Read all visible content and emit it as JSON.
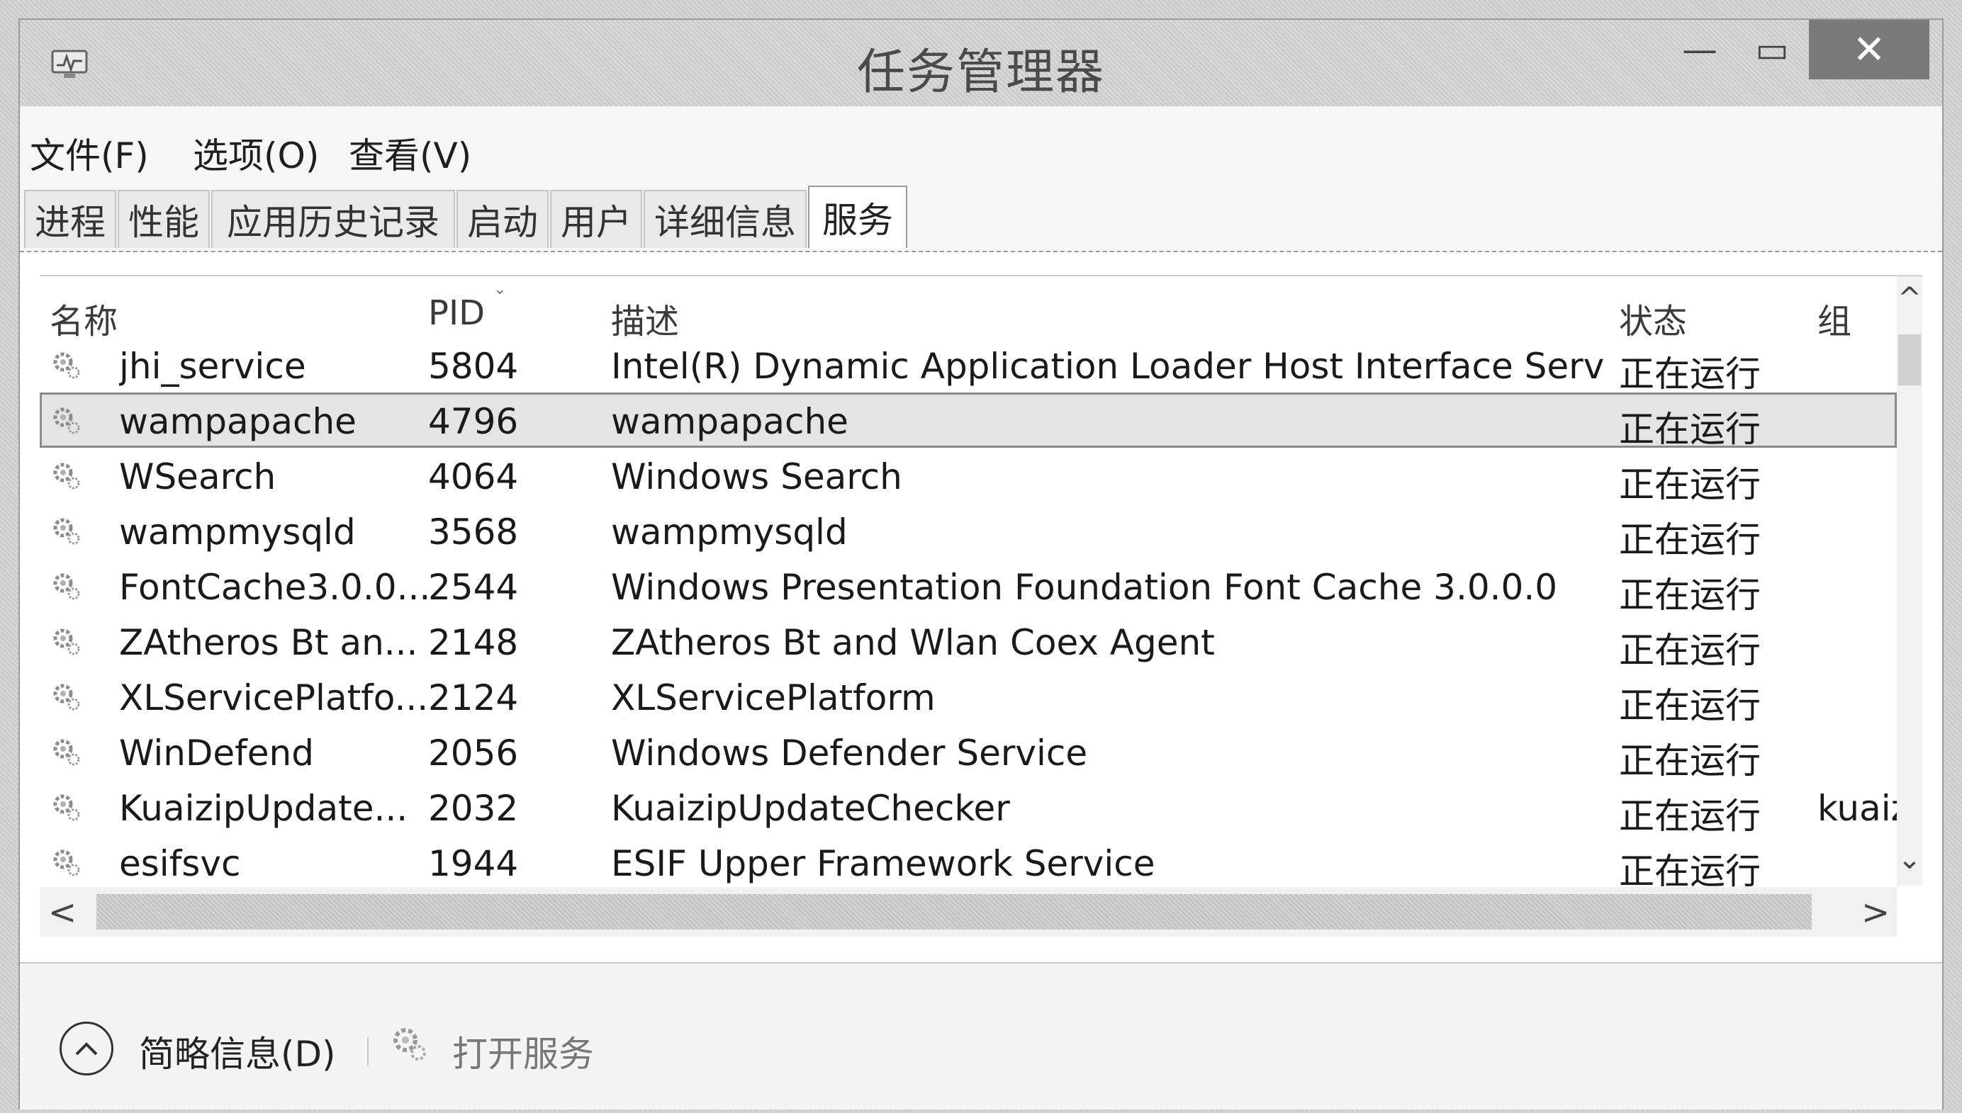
{
  "window": {
    "title": "任务管理器",
    "close_glyph": "✕",
    "minimize_glyph": "—",
    "maximize_glyph": "▭"
  },
  "menu": {
    "items": [
      "文件(F)",
      "选项(O)",
      "查看(V)"
    ]
  },
  "tabs": {
    "items": [
      "进程",
      "性能",
      "应用历史记录",
      "启动",
      "用户",
      "详细信息",
      "服务"
    ],
    "active": "服务"
  },
  "table": {
    "headers": {
      "name": "名称",
      "pid": "PID",
      "description": "描述",
      "status": "状态",
      "group": "组"
    },
    "rows": [
      {
        "name": "jhi_service",
        "pid": "5804",
        "description": "Intel(R) Dynamic Application Loader Host Interface Servi...",
        "status": "正在运行",
        "group": ""
      },
      {
        "name": "wampapache",
        "pid": "4796",
        "description": "wampapache",
        "status": "正在运行",
        "group": ""
      },
      {
        "name": "WSearch",
        "pid": "4064",
        "description": "Windows Search",
        "status": "正在运行",
        "group": ""
      },
      {
        "name": "wampmysqld",
        "pid": "3568",
        "description": "wampmysqld",
        "status": "正在运行",
        "group": ""
      },
      {
        "name": "FontCache3.0.0...",
        "pid": "2544",
        "description": "Windows Presentation Foundation Font Cache 3.0.0.0",
        "status": "正在运行",
        "group": ""
      },
      {
        "name": "ZAtheros Bt an...",
        "pid": "2148",
        "description": "ZAtheros Bt and Wlan Coex Agent",
        "status": "正在运行",
        "group": ""
      },
      {
        "name": "XLServicePlatfo...",
        "pid": "2124",
        "description": "XLServicePlatform",
        "status": "正在运行",
        "group": ""
      },
      {
        "name": "WinDefend",
        "pid": "2056",
        "description": "Windows Defender Service",
        "status": "正在运行",
        "group": ""
      },
      {
        "name": "KuaizipUpdate...",
        "pid": "2032",
        "description": "KuaizipUpdateChecker",
        "status": "正在运行",
        "group": "kuaizi"
      },
      {
        "name": "esifsvc",
        "pid": "1944",
        "description": "ESIF Upper Framework Service",
        "status": "正在运行",
        "group": ""
      }
    ],
    "selected_index": 1
  },
  "scroll": {
    "up_glyph": "^",
    "down_glyph": "⌄",
    "left_glyph": "<",
    "right_glyph": ">"
  },
  "footer": {
    "collapse_label": "简略信息(D)",
    "open_services_label": "打开服务"
  },
  "icons": {
    "app": "task-manager-icon",
    "service": "gear-icon",
    "collapse": "chevron-up-icon"
  },
  "colors": {
    "close_button": "#7a7a7a",
    "selected_row": "#e4e4e4",
    "disabled_text": "#777777"
  }
}
